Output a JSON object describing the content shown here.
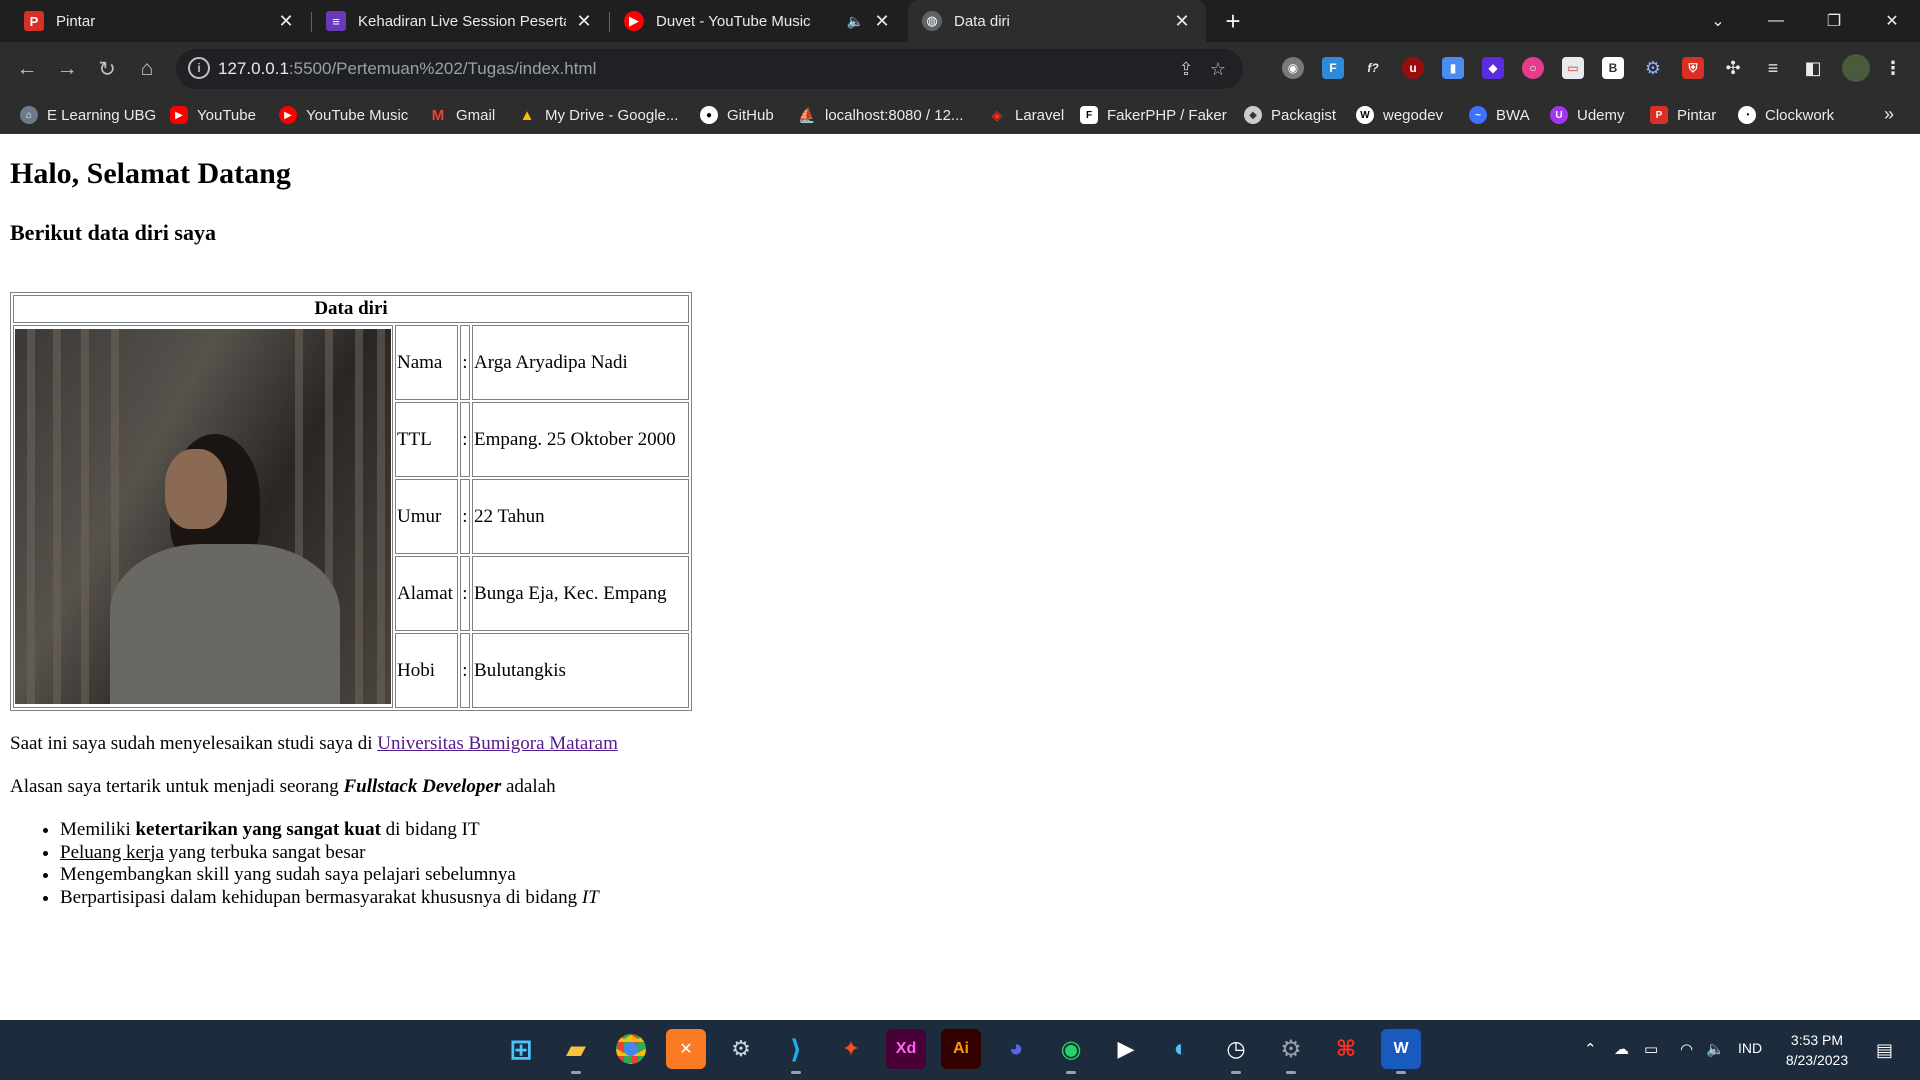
{
  "browser": {
    "tabs": [
      {
        "title": "Pintar",
        "icon": "pintar-favicon-icon",
        "color": "#d93025"
      },
      {
        "title": "Kehadiran Live Session Peserta D",
        "icon": "forms-favicon-icon",
        "color": "#673ab7"
      },
      {
        "title": "Duvet - YouTube Music",
        "icon": "youtube-music-favicon-icon",
        "color": "#ff0000"
      },
      {
        "title": "Data diri",
        "icon": "globe-favicon-icon",
        "color": "#9aa0a6"
      }
    ],
    "url_host": "127.0.0.1",
    "url_path": ":5500/Pertemuan%202/Tugas/index.html",
    "bookmarks": [
      {
        "label": "E Learning UBG",
        "icon": "elearning-icon",
        "color": "#6c7a89"
      },
      {
        "label": "YouTube",
        "icon": "youtube-icon",
        "color": "#ff0000"
      },
      {
        "label": "YouTube Music",
        "icon": "youtube-music-icon",
        "color": "#ff0000"
      },
      {
        "label": "Gmail",
        "icon": "gmail-icon",
        "color": "#ea4335"
      },
      {
        "label": "My Drive - Google...",
        "icon": "google-drive-icon",
        "color": "#34a853"
      },
      {
        "label": "GitHub",
        "icon": "github-icon",
        "color": "#ffffff"
      },
      {
        "label": "localhost:8080 / 12...",
        "icon": "phpmyadmin-icon",
        "color": "#f89c0e"
      },
      {
        "label": "Laravel",
        "icon": "laravel-icon",
        "color": "#ff2d20"
      },
      {
        "label": "FakerPHP / Faker",
        "icon": "fakerphp-icon",
        "color": "#ffffff"
      },
      {
        "label": "Packagist",
        "icon": "packagist-icon",
        "color": "#cccccc"
      },
      {
        "label": "wegodev",
        "icon": "wegodev-icon",
        "color": "#ffffff"
      },
      {
        "label": "BWA",
        "icon": "bwa-icon",
        "color": "#3f71ff"
      },
      {
        "label": "Udemy",
        "icon": "udemy-icon",
        "color": "#a435f0"
      },
      {
        "label": "Pintar",
        "icon": "pintar-icon",
        "color": "#d93025"
      },
      {
        "label": "Clockwork",
        "icon": "clockwork-icon",
        "color": "#ffffff"
      }
    ]
  },
  "page": {
    "heading": "Halo, Selamat Datang",
    "subheading": "Berikut data diri saya",
    "table": {
      "title": "Data diri",
      "separator": ":",
      "rows": [
        {
          "label": "Nama",
          "value": "Arga Aryadipa Nadi"
        },
        {
          "label": "TTL",
          "value": "Empang. 25 Oktober 2000"
        },
        {
          "label": "Umur",
          "value": "22 Tahun"
        },
        {
          "label": "Alamat",
          "value": "Bunga Eja, Kec. Empang"
        },
        {
          "label": "Hobi",
          "value": "Bulutangkis"
        }
      ]
    },
    "study_text": "Saat ini saya sudah menyelesaikan studi saya di ",
    "university_link": "Universitas Bumigora Mataram",
    "reason_intro": "Alasan saya tertarik untuk menjadi seorang ",
    "reason_role": "Fullstack Developer",
    "reason_suffix": " adalah",
    "reasons": {
      "r1_pre": "Memiliki ",
      "r1_bold": "ketertarikan yang sangat kuat",
      "r1_post": " di bidang IT",
      "r2_under": "Peluang kerja",
      "r2_post": " yang terbuka sangat besar",
      "r3": "Mengembangkan skill yang sudah saya pelajari sebelumnya",
      "r4_pre": "Berpartisipasi dalam kehidupan bermasyarakat khususnya di bidang ",
      "r4_ital": "IT"
    }
  },
  "taskbar": {
    "language": "IND",
    "time": "3:53 PM",
    "date": "8/23/2023"
  }
}
